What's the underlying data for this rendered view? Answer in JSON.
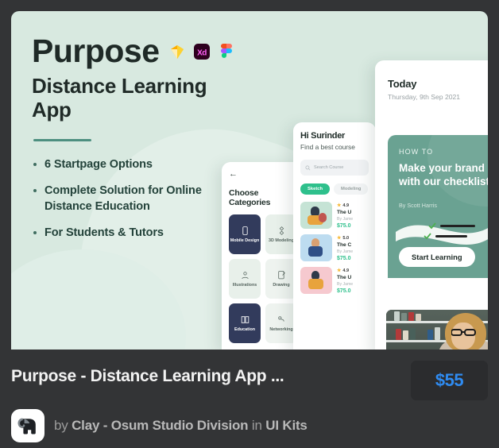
{
  "hero": {
    "title_main": "Purpose",
    "title_sub": "Distance Learning App",
    "tools": [
      {
        "name": "sketch-icon",
        "label": "Sketch"
      },
      {
        "name": "adobe-xd-icon",
        "label": "Xd"
      },
      {
        "name": "figma-icon",
        "label": "Figma"
      }
    ],
    "bullets": [
      "6 Startpage Options",
      "Complete Solution for Online Distance Education",
      "For Students & Tutors"
    ],
    "bg_color": "#d8e9e0",
    "accent_color": "#4d8f80"
  },
  "mockups": {
    "categories_screen": {
      "back_label": "←",
      "title": "Choose Categories",
      "items": [
        {
          "label": "Mobile Design",
          "style": "dark"
        },
        {
          "label": "3D Modeling",
          "style": "light"
        },
        {
          "label": "Illustrations",
          "style": "light"
        },
        {
          "label": "Drawing",
          "style": "pale"
        },
        {
          "label": "Education",
          "style": "dark"
        },
        {
          "label": "Networking",
          "style": "pale"
        }
      ]
    },
    "home_screen": {
      "greeting": "Hi Surinder",
      "subtitle": "Find a best course",
      "search_placeholder": "Search Course",
      "chips": [
        {
          "label": "Sketch",
          "active": true
        },
        {
          "label": "Modeling",
          "active": false
        }
      ],
      "courses": [
        {
          "rating": "4.9",
          "name": "The U",
          "author": "By Jame",
          "price": "$75.0",
          "thumb": "#c5e3d5"
        },
        {
          "rating": "5.0",
          "name": "The C",
          "author": "By Jame",
          "price": "$75.0",
          "thumb": "#bddcf0"
        },
        {
          "rating": "4.9",
          "name": "The U",
          "author": "By Jame",
          "price": "$75.0",
          "thumb": "#f6c9cf"
        }
      ]
    },
    "today_screen": {
      "title": "Today",
      "date": "Thursday, 9th Sep 2021",
      "kicker": "HOW TO",
      "headline": "Make your brand more with our checklist.",
      "headline_line1": "Make your brand more",
      "headline_line2": "with our checklist.",
      "author": "By Scott Harris",
      "cta": "Start Learning",
      "promo_color": "#6aa292"
    }
  },
  "footer": {
    "title": "Purpose - Distance Learning App ...",
    "price": "$55",
    "price_color": "#2f8bf0",
    "by_prefix": "by",
    "author": "Clay - Osum Studio Division",
    "in_prefix": "in",
    "category": "UI Kits"
  }
}
